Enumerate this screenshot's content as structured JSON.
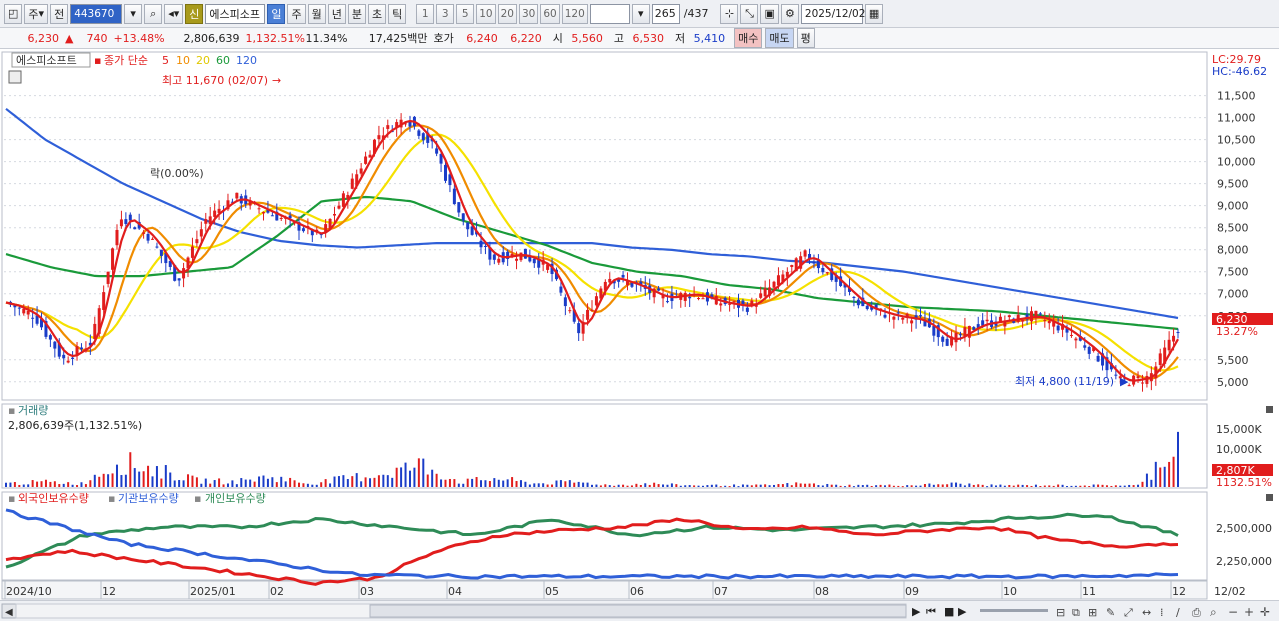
{
  "toolbar": {
    "period_sel": "주",
    "prev_label": "전",
    "code": "443670",
    "name": "에스피소프",
    "credit_badge": "신",
    "tabs": [
      "일",
      "주",
      "월",
      "년",
      "분",
      "초",
      "틱"
    ],
    "active_tab": "일",
    "numbers": [
      "1",
      "3",
      "5",
      "10",
      "20",
      "30",
      "60",
      "120"
    ],
    "count": "265",
    "total": "/437",
    "date": "2025/12/02"
  },
  "info": {
    "price": "6,230",
    "change": "740",
    "pct": "+13.48%",
    "volume": "2,806,639",
    "vol_pct": "1,132.51%",
    "turnover": "11.34%",
    "amount": "17,425백만",
    "hoga_label": "호가",
    "ask": "6,240",
    "bid": "6,220",
    "open_label": "시",
    "open": "5,560",
    "high_label": "고",
    "high": "6,530",
    "low_label": "저",
    "low": "5,410",
    "buy_label": "매수",
    "sell_label": "매도",
    "avg_label": "평"
  },
  "price_panel": {
    "stock_tag": "에스피소프트",
    "legend_prefix": "종가 단순",
    "ma_labels": [
      "5",
      "10",
      "20",
      "60",
      "120"
    ],
    "ma_colors": [
      "#e11d1d",
      "#f08c00",
      "#f5e100",
      "#1a9a3a",
      "#2f5fd8"
    ],
    "lc": "LC:29.79",
    "hc": "HC:-46.62",
    "max_label": "최고 11,670 (02/07)",
    "min_label": "최저 4,800 (11/19)",
    "event_label": "락(0.00%)",
    "current_price_tag": "6,230",
    "current_pct_tag": "13.27%",
    "y_ticks": [
      "11,500",
      "11,000",
      "10,500",
      "10,000",
      "9,500",
      "9,000",
      "8,500",
      "8,000",
      "7,500",
      "7,000",
      "6,500",
      "5,500",
      "5,000"
    ]
  },
  "volume_panel": {
    "title": "거래량",
    "value": "2,806,639주(1,132.51%)",
    "y_ticks": [
      "15,000K",
      "10,000K"
    ],
    "current_tag": "2,807K",
    "current_pct": "1132.51%"
  },
  "holding_panel": {
    "legend": [
      "외국인보유수량",
      "기관보유수량",
      "개인보유수량"
    ],
    "legend_colors": [
      "#e11d1d",
      "#2f5fd8",
      "#2e8b57"
    ],
    "y_ticks": [
      "2,500,000",
      "2,250,000"
    ]
  },
  "x_axis": {
    "labels": [
      "2024/10",
      "12",
      "2025/01",
      "02",
      "03",
      "04",
      "05",
      "06",
      "07",
      "08",
      "09",
      "10",
      "11",
      "12",
      "12/02"
    ]
  },
  "chart_data": {
    "type": "candlestick",
    "x_axis_months": [
      "2024/10",
      "12",
      "2025/01",
      "02",
      "03",
      "04",
      "05",
      "06",
      "07",
      "08",
      "09",
      "10",
      "11",
      "12"
    ],
    "y_range": [
      4700,
      11900
    ],
    "highest": {
      "value": 11670,
      "date": "02/07"
    },
    "lowest": {
      "value": 4800,
      "date": "11/19"
    },
    "last_close": 6230,
    "close_series": [
      6800,
      6500,
      5500,
      5900,
      8800,
      8300,
      7300,
      8700,
      9200,
      8900,
      8600,
      8300,
      9400,
      10600,
      11000,
      10300,
      8600,
      7800,
      7900,
      7600,
      6100,
      7400,
      7200,
      6900,
      7000,
      6800,
      6700,
      7300,
      7900,
      7300,
      6700,
      6500,
      6400,
      5900,
      6300,
      6400,
      6500,
      6200,
      5700,
      5000,
      5100,
      6230
    ],
    "ma120_series": [
      11200,
      10500,
      10000,
      9500,
      9100,
      8700,
      8400,
      8200,
      8100,
      8050,
      8100,
      8150,
      8150,
      8150,
      8150,
      8150,
      8050,
      8000,
      7900,
      7850,
      7750,
      7700,
      7600,
      7500,
      7350,
      7200,
      7050,
      6900,
      6750,
      6600,
      6450
    ],
    "ma60_series": [
      7900,
      7600,
      7400,
      7400,
      7500,
      7600,
      8300,
      9100,
      9200,
      9100,
      8700,
      8400,
      8100,
      7700,
      7500,
      7400,
      7200,
      7100,
      6900,
      6800,
      6700,
      6650,
      6600,
      6500,
      6400,
      6300,
      6200
    ],
    "volume_series": [
      2,
      3,
      2,
      15,
      10,
      4,
      3,
      6,
      2,
      5,
      8,
      13,
      3,
      5,
      2,
      3,
      1,
      2,
      1,
      1,
      1,
      2,
      1,
      1,
      1,
      2,
      1,
      1,
      1,
      1,
      1,
      28
    ],
    "foreign_series": [
      2300000,
      2350000,
      2300000,
      2250000,
      2200000,
      2150000,
      2180000,
      2350000,
      2450000,
      2480000,
      2500000,
      2550000,
      2480000,
      2500000,
      2450000,
      2480000,
      2500000,
      2420000,
      2380000,
      2400000
    ],
    "institution_series": [
      2600000,
      2400000,
      2300000,
      2200000,
      2190000,
      2190000,
      2190000,
      2190000,
      2190000,
      2190000,
      2200000
    ],
    "individual_series": [
      2250000,
      2450000,
      2500000,
      2500000,
      2550000,
      2500000,
      2450000,
      2550000,
      2450000,
      2500000,
      2480000,
      2500000,
      2520000,
      2560000,
      2580000,
      2450000
    ]
  }
}
